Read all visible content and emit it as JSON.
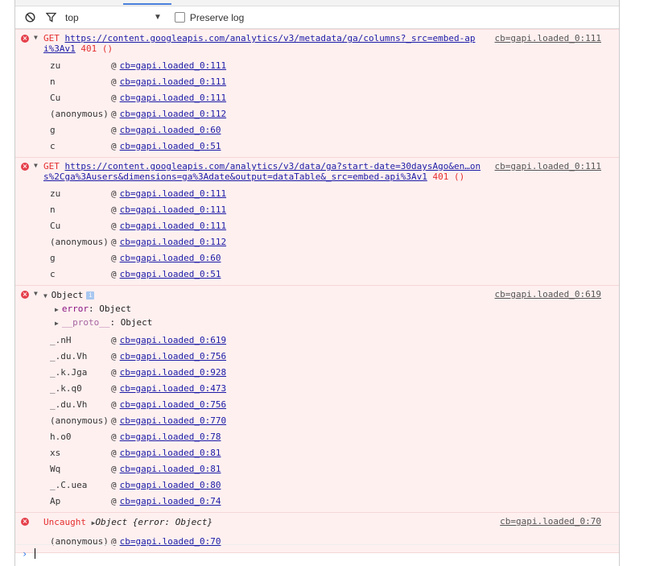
{
  "toolbar": {
    "context": "top",
    "preserve_log": "Preserve log"
  },
  "messages": [
    {
      "method": "GET",
      "url_part1": "https://content.googleapis.com/analytics/v3/metadata/ga/columns?_src=embed-",
      "url_part2": "api%3Av1",
      "status": "401 ()",
      "source": "cb=gapi.loaded_0:111",
      "frames": [
        {
          "fn": "zu",
          "loc": "cb=gapi.loaded_0:111"
        },
        {
          "fn": "n",
          "loc": "cb=gapi.loaded_0:111"
        },
        {
          "fn": "Cu",
          "loc": "cb=gapi.loaded_0:111"
        },
        {
          "fn": "(anonymous)",
          "loc": "cb=gapi.loaded_0:112"
        },
        {
          "fn": "g",
          "loc": "cb=gapi.loaded_0:60"
        },
        {
          "fn": "c",
          "loc": "cb=gapi.loaded_0:51"
        }
      ]
    },
    {
      "method": "GET",
      "url_part1": "https://content.googleapis.com/analytics/v3/data/ga?start-date=30daysAgo&en…",
      "url_part2": "ons%2Cga%3Ausers&dimensions=ga%3Adate&output=dataTable&_src=embed-api%3Av1",
      "status": "401 ()",
      "source": "cb=gapi.loaded_0:111",
      "frames": [
        {
          "fn": "zu",
          "loc": "cb=gapi.loaded_0:111"
        },
        {
          "fn": "n",
          "loc": "cb=gapi.loaded_0:111"
        },
        {
          "fn": "Cu",
          "loc": "cb=gapi.loaded_0:111"
        },
        {
          "fn": "(anonymous)",
          "loc": "cb=gapi.loaded_0:112"
        },
        {
          "fn": "g",
          "loc": "cb=gapi.loaded_0:60"
        },
        {
          "fn": "c",
          "loc": "cb=gapi.loaded_0:51"
        }
      ]
    }
  ],
  "object_msg": {
    "label": "Object",
    "source": "cb=gapi.loaded_0:619",
    "prop1_key": "error",
    "prop1_val": "Object",
    "prop2_key": "__proto__",
    "prop2_val": "Object",
    "frames": [
      {
        "fn": "_.nH",
        "loc": "cb=gapi.loaded_0:619"
      },
      {
        "fn": "_.du.Vh",
        "loc": "cb=gapi.loaded_0:756"
      },
      {
        "fn": "_.k.Jga",
        "loc": "cb=gapi.loaded_0:928"
      },
      {
        "fn": "_.k.q0",
        "loc": "cb=gapi.loaded_0:473"
      },
      {
        "fn": "_.du.Vh",
        "loc": "cb=gapi.loaded_0:756"
      },
      {
        "fn": "(anonymous)",
        "loc": "cb=gapi.loaded_0:770"
      },
      {
        "fn": "h.o0",
        "loc": "cb=gapi.loaded_0:78"
      },
      {
        "fn": "xs",
        "loc": "cb=gapi.loaded_0:81"
      },
      {
        "fn": "Wq",
        "loc": "cb=gapi.loaded_0:81"
      },
      {
        "fn": "_.C.uea",
        "loc": "cb=gapi.loaded_0:80"
      },
      {
        "fn": "Ap",
        "loc": "cb=gapi.loaded_0:74"
      }
    ]
  },
  "uncaught_msg": {
    "label": "Uncaught",
    "object_text": "Object {error: Object}",
    "source": "cb=gapi.loaded_0:70",
    "frames": [
      {
        "fn": "(anonymous)",
        "loc": "cb=gapi.loaded_0:70"
      }
    ]
  }
}
